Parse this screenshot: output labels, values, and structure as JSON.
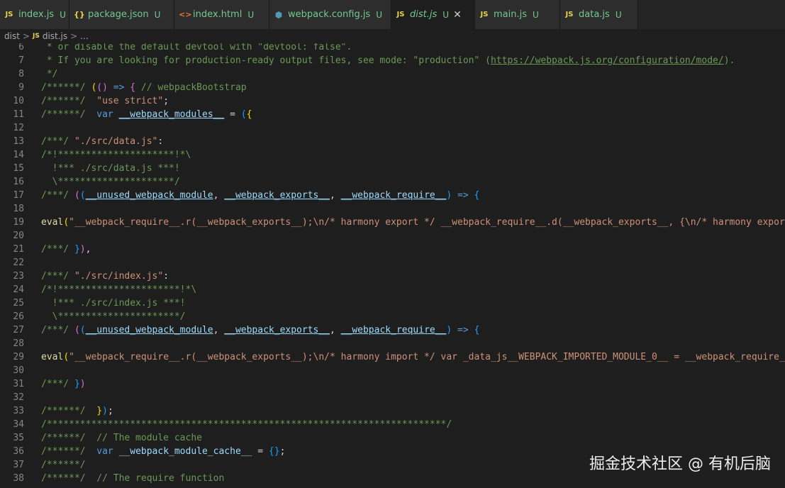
{
  "tabs": [
    {
      "label": "index.js",
      "status": "U",
      "icon": "js-icon",
      "glyph": "JS"
    },
    {
      "label": "package.json",
      "status": "U",
      "icon": "json-icon",
      "glyph": "{}"
    },
    {
      "label": "index.html",
      "status": "U",
      "icon": "html-icon",
      "glyph": "<>"
    },
    {
      "label": "webpack.config.js",
      "status": "U",
      "icon": "webpack-icon",
      "glyph": "⬢"
    },
    {
      "label": "dist.js",
      "status": "U",
      "icon": "js-icon",
      "glyph": "JS",
      "active": true,
      "close": "✕"
    },
    {
      "label": "main.js",
      "status": "U",
      "icon": "js-icon",
      "glyph": "JS"
    },
    {
      "label": "data.js",
      "status": "U",
      "icon": "js-icon",
      "glyph": "JS"
    }
  ],
  "breadcrumb": {
    "folder": "dist",
    "file_glyph": "JS",
    "file": "dist.js",
    "symbol": "...",
    "sep": ">"
  },
  "editor": {
    "lines": [
      {
        "n": "6",
        "parts": [
          [
            "c",
            " * or disable the default devtool with \"devtool: false\"."
          ]
        ]
      },
      {
        "n": "7",
        "parts": [
          [
            "c",
            " * If you are looking for production-ready output files, see mode: \"production\" ("
          ],
          [
            "l",
            "https://webpack.js.org/configuration/mode/"
          ],
          [
            "c",
            ")."
          ]
        ]
      },
      {
        "n": "8",
        "parts": [
          [
            "c",
            " */"
          ]
        ]
      },
      {
        "n": "9",
        "parts": [
          [
            "c",
            "/******/ "
          ],
          [
            "b1",
            "("
          ],
          [
            "b2",
            "("
          ],
          [
            "b2",
            ")"
          ],
          [
            "k",
            " => "
          ],
          [
            "b2",
            "{"
          ],
          [
            "c",
            " // webpackBootstrap"
          ]
        ]
      },
      {
        "n": "10",
        "parts": [
          [
            "c",
            "/******/  "
          ],
          [
            "s",
            "\"use strict\""
          ],
          [
            "p",
            ";"
          ]
        ]
      },
      {
        "n": "11",
        "parts": [
          [
            "c",
            "/******/  "
          ],
          [
            "k",
            "var "
          ],
          [
            "v",
            "__webpack_modules__"
          ],
          [
            "p",
            " = "
          ],
          [
            "b3",
            "("
          ],
          [
            "b1",
            "{"
          ]
        ]
      },
      {
        "n": "12",
        "parts": []
      },
      {
        "n": "13",
        "parts": [
          [
            "c",
            "/***/ "
          ],
          [
            "s",
            "\"./src/data.js\""
          ],
          [
            "p",
            ":"
          ]
        ]
      },
      {
        "n": "14",
        "parts": [
          [
            "c",
            "/*!*********************!*\\"
          ]
        ]
      },
      {
        "n": "15",
        "parts": [
          [
            "c",
            "  !*** ./src/data.js ***!"
          ]
        ]
      },
      {
        "n": "16",
        "parts": [
          [
            "c",
            "  \\*********************/"
          ]
        ]
      },
      {
        "n": "17",
        "parts": [
          [
            "c",
            "/***/ "
          ],
          [
            "b2",
            "("
          ],
          [
            "b3",
            "("
          ],
          [
            "v",
            "__unused_webpack_module"
          ],
          [
            "p",
            ", "
          ],
          [
            "v",
            "__webpack_exports__"
          ],
          [
            "p",
            ", "
          ],
          [
            "v",
            "__webpack_require__"
          ],
          [
            "b3",
            ")"
          ],
          [
            "k",
            " => "
          ],
          [
            "b3",
            "{"
          ]
        ]
      },
      {
        "n": "18",
        "parts": []
      },
      {
        "n": "19",
        "parts": [
          [
            "f",
            "eval"
          ],
          [
            "b1",
            "("
          ],
          [
            "s",
            "\"__webpack_require__.r(__webpack_exports__);\\n/* harmony export */ __webpack_require__.d(__webpack_exports__, {\\n/* harmony export */ "
          ]
        ]
      },
      {
        "n": "20",
        "parts": []
      },
      {
        "n": "21",
        "parts": [
          [
            "c",
            "/***/ "
          ],
          [
            "b3",
            "}"
          ],
          [
            "b2",
            ")"
          ],
          [
            "p",
            ","
          ]
        ]
      },
      {
        "n": "22",
        "parts": []
      },
      {
        "n": "23",
        "parts": [
          [
            "c",
            "/***/ "
          ],
          [
            "s",
            "\"./src/index.js\""
          ],
          [
            "p",
            ":"
          ]
        ]
      },
      {
        "n": "24",
        "parts": [
          [
            "c",
            "/*!**********************!*\\"
          ]
        ]
      },
      {
        "n": "25",
        "parts": [
          [
            "c",
            "  !*** ./src/index.js ***!"
          ]
        ]
      },
      {
        "n": "26",
        "parts": [
          [
            "c",
            "  \\**********************/"
          ]
        ]
      },
      {
        "n": "27",
        "parts": [
          [
            "c",
            "/***/ "
          ],
          [
            "b2",
            "("
          ],
          [
            "b3",
            "("
          ],
          [
            "v",
            "__unused_webpack_module"
          ],
          [
            "p",
            ", "
          ],
          [
            "v",
            "__webpack_exports__"
          ],
          [
            "p",
            ", "
          ],
          [
            "v",
            "__webpack_require__"
          ],
          [
            "b3",
            ")"
          ],
          [
            "k",
            " => "
          ],
          [
            "b3",
            "{"
          ]
        ]
      },
      {
        "n": "28",
        "parts": []
      },
      {
        "n": "29",
        "parts": [
          [
            "f",
            "eval"
          ],
          [
            "b1",
            "("
          ],
          [
            "s",
            "\"__webpack_require__.r(__webpack_exports__);\\n/* harmony import */ var _data_js__WEBPACK_IMPORTED_MODULE_0__ = __webpack_require__(/"
          ]
        ]
      },
      {
        "n": "30",
        "parts": []
      },
      {
        "n": "31",
        "parts": [
          [
            "c",
            "/***/ "
          ],
          [
            "b3",
            "}"
          ],
          [
            "b2",
            ")"
          ]
        ]
      },
      {
        "n": "32",
        "parts": []
      },
      {
        "n": "33",
        "parts": [
          [
            "c",
            "/******/  "
          ],
          [
            "b1",
            "}"
          ],
          [
            "b3",
            ")"
          ],
          [
            "p",
            ";"
          ]
        ]
      },
      {
        "n": "34",
        "parts": [
          [
            "c",
            "/************************************************************************/"
          ]
        ]
      },
      {
        "n": "35",
        "parts": [
          [
            "c",
            "/******/  // The module cache"
          ]
        ]
      },
      {
        "n": "36",
        "parts": [
          [
            "c",
            "/******/  "
          ],
          [
            "k",
            "var "
          ],
          [
            "v2",
            "__webpack_module_cache__"
          ],
          [
            "p",
            " = "
          ],
          [
            "b3",
            "{}"
          ],
          [
            "p",
            ";"
          ]
        ]
      },
      {
        "n": "37",
        "parts": [
          [
            "c",
            "/******/"
          ]
        ]
      },
      {
        "n": "38",
        "parts": [
          [
            "c",
            "/******/  // The require function"
          ]
        ]
      }
    ]
  },
  "watermark": "掘金技术社区 @ 有机后脑"
}
